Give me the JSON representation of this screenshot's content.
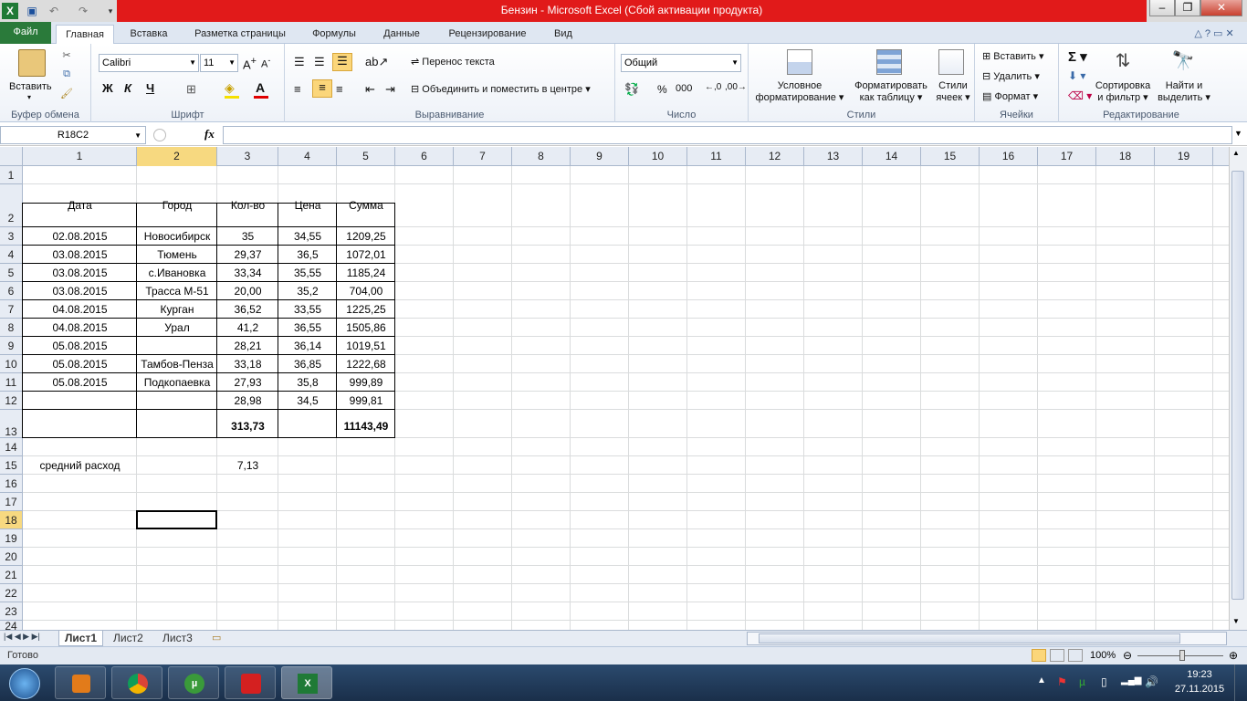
{
  "window": {
    "title": "Бензин - Microsoft Excel (Сбой активации продукта)"
  },
  "ribbon_tabs": [
    "Файл",
    "Главная",
    "Вставка",
    "Разметка страницы",
    "Формулы",
    "Данные",
    "Рецензирование",
    "Вид"
  ],
  "clipboard": {
    "paste": "Вставить",
    "label": "Буфер обмена"
  },
  "font": {
    "name": "Calibri",
    "size": "11",
    "label": "Шрифт",
    "bold": "Ж",
    "italic": "К",
    "underline": "Ч"
  },
  "alignment": {
    "wrap": "Перенос текста",
    "merge": "Объединить и поместить в центре",
    "label": "Выравнивание"
  },
  "number": {
    "format": "Общий",
    "label": "Число",
    "percent": "%",
    "thousands": "000"
  },
  "styles": {
    "conditional": "Условное\nформатирование",
    "cond1": "Условное",
    "cond2": "форматирование",
    "table1": "Форматировать",
    "table2": "как таблицу",
    "cell1": "Стили",
    "cell2": "ячеек",
    "label": "Стили"
  },
  "cells": {
    "insert": "Вставить",
    "delete": "Удалить",
    "format": "Формат",
    "label": "Ячейки"
  },
  "editing": {
    "sort1": "Сортировка",
    "sort2": "и фильтр",
    "find1": "Найти и",
    "find2": "выделить",
    "label": "Редактирование"
  },
  "formula_bar": {
    "name_box": "R18C2",
    "fx": "fx",
    "value": ""
  },
  "columns": [
    "1",
    "2",
    "3",
    "4",
    "5",
    "6",
    "7",
    "8",
    "9",
    "10",
    "11",
    "12",
    "13",
    "14",
    "15",
    "16",
    "17",
    "18",
    "19"
  ],
  "rows": [
    "1",
    "2",
    "3",
    "4",
    "5",
    "6",
    "7",
    "8",
    "9",
    "10",
    "11",
    "12",
    "13",
    "14",
    "15",
    "16",
    "17",
    "18",
    "19",
    "20",
    "21",
    "22",
    "23",
    "24"
  ],
  "table": {
    "headers": [
      "Дата",
      "Город",
      "Кол-во",
      "Цена",
      "Сумма"
    ],
    "rows": [
      [
        "02.08.2015",
        "Новосибирск",
        "35",
        "34,55",
        "1209,25"
      ],
      [
        "03.08.2015",
        "Тюмень",
        "29,37",
        "36,5",
        "1072,01"
      ],
      [
        "03.08.2015",
        "с.Ивановка",
        "33,34",
        "35,55",
        "1185,24"
      ],
      [
        "03.08.2015",
        "Трасса М-51",
        "20,00",
        "35,2",
        "704,00"
      ],
      [
        "04.08.2015",
        "Курган",
        "36,52",
        "33,55",
        "1225,25"
      ],
      [
        "04.08.2015",
        "Урал",
        "41,2",
        "36,55",
        "1505,86"
      ],
      [
        "05.08.2015",
        "",
        "28,21",
        "36,14",
        "1019,51"
      ],
      [
        "05.08.2015",
        "Тамбов-Пенза",
        "33,18",
        "36,85",
        "1222,68"
      ],
      [
        "05.08.2015",
        "Подкопаевка",
        "27,93",
        "35,8",
        "999,89"
      ],
      [
        "",
        "",
        "28,98",
        "34,5",
        "999,81"
      ]
    ],
    "total_qty": "313,73",
    "total_sum": "11143,49"
  },
  "avg": {
    "label": "средний расход",
    "value": "7,13"
  },
  "sheets": [
    "Лист1",
    "Лист2",
    "Лист3"
  ],
  "status": {
    "ready": "Готово",
    "zoom": "100%"
  },
  "taskbar": {
    "time": "19:23",
    "date": "27.11.2015"
  },
  "colors": {
    "title_red": "#e11a1a",
    "file_tab": "#2a7a3a",
    "selected_header": "#f7d980"
  }
}
